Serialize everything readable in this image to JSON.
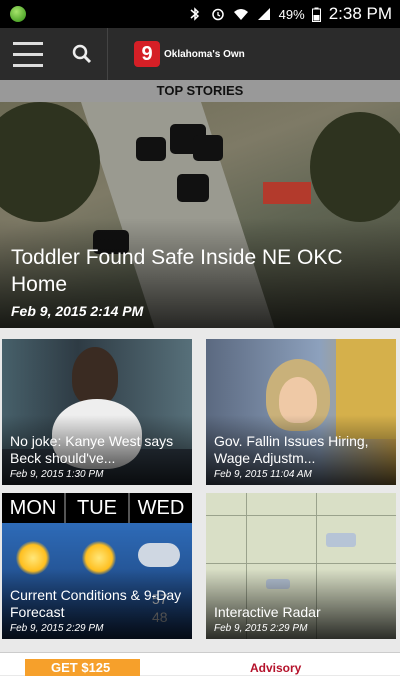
{
  "status_bar": {
    "battery": "49%",
    "time": "2:38 PM"
  },
  "app_bar": {
    "brand_badge": "9",
    "brand_name": "Oklahoma's Own"
  },
  "section": {
    "title": "TOP STORIES"
  },
  "hero": {
    "headline": "Toddler Found Safe Inside NE OKC Home",
    "date": "Feb 9, 2015 2:14 PM"
  },
  "cards": [
    {
      "title": "No joke: Kanye West says Beck should've...",
      "date": "Feb 9, 2015 1:30 PM"
    },
    {
      "title": "Gov. Fallin Issues Hiring, Wage Adjustm...",
      "date": "Feb 9, 2015 11:04 AM"
    },
    {
      "title": "Current Conditions & 9-Day Forecast",
      "date": "Feb 9, 2015 2:29 PM"
    },
    {
      "title": "Interactive Radar",
      "date": "Feb 9, 2015 2:29 PM"
    }
  ],
  "forecast": {
    "days": [
      "MON",
      "TUE",
      "WED"
    ],
    "temps": [
      "57",
      "48"
    ]
  },
  "ad": {
    "left_text": "GET $125",
    "right_text": "Advisory"
  },
  "colors": {
    "brand_red": "#d51f26",
    "app_bar": "#2b2b2b",
    "section_bar": "#999999"
  },
  "icons": [
    "green-notification-icon",
    "bluetooth-icon",
    "alarm-icon",
    "wifi-icon",
    "signal-icon",
    "battery-icon",
    "menu-icon",
    "search-icon"
  ]
}
